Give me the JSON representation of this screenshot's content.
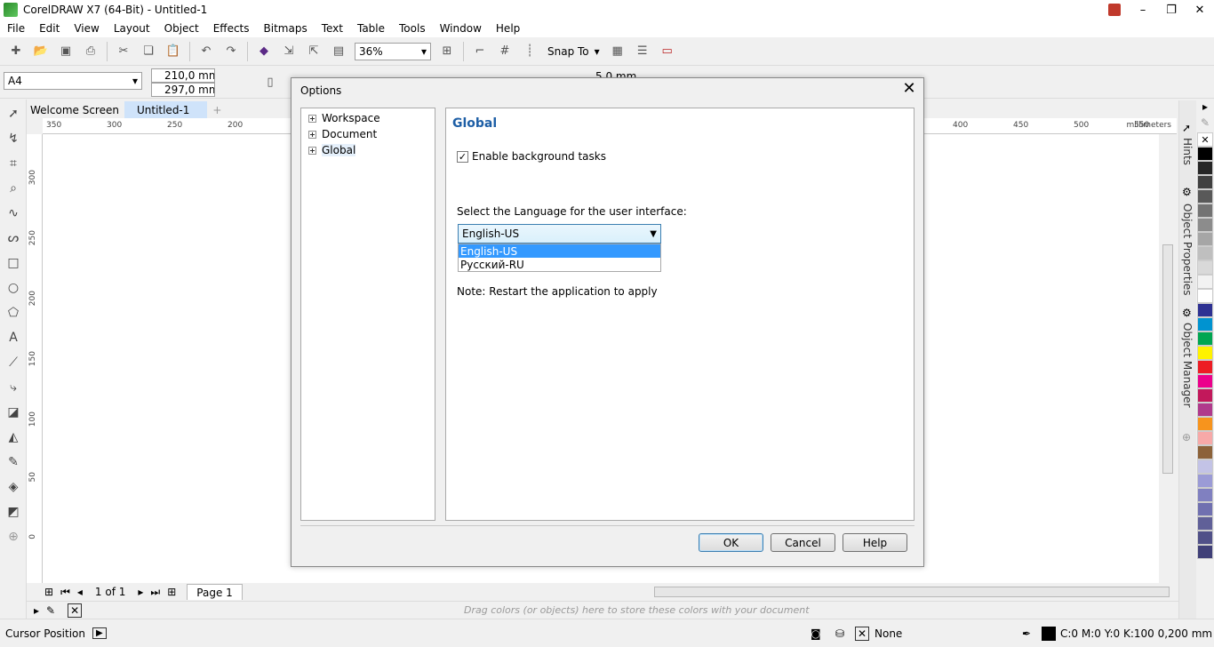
{
  "window": {
    "title": "CorelDRAW X7 (64-Bit) - Untitled-1"
  },
  "menu": [
    "File",
    "Edit",
    "View",
    "Layout",
    "Object",
    "Effects",
    "Bitmaps",
    "Text",
    "Table",
    "Tools",
    "Window",
    "Help"
  ],
  "toolbar": {
    "zoom": "36%",
    "snap_label": "Snap To"
  },
  "property_bar": {
    "page_size": "A4",
    "width": "210,0 mm",
    "height": "297,0 mm",
    "nudge": "5,0 mm"
  },
  "tabs": {
    "welcome": "Welcome Screen",
    "doc": "Untitled-1"
  },
  "ruler": {
    "units": "millimeters",
    "h_ticks": [
      "350",
      "300",
      "250",
      "200",
      "400",
      "450",
      "500",
      "550"
    ],
    "v_ticks": [
      "300",
      "250",
      "200",
      "150",
      "100",
      "50",
      "0"
    ]
  },
  "page_nav": {
    "position": "1 of 1",
    "page": "Page 1"
  },
  "doc_palette": {
    "hint": "Drag colors (or objects) here to store these colors with your document"
  },
  "status": {
    "cursor": "Cursor Position",
    "fill": "None",
    "outline": "C:0 M:0 Y:0 K:100  0,200 mm"
  },
  "dockers": [
    "Hints",
    "Object Properties",
    "Object Manager"
  ],
  "palette_colors": [
    "#000000",
    "#262626",
    "#404040",
    "#595959",
    "#737373",
    "#8c8c8c",
    "#a6a6a6",
    "#bfbfbf",
    "#d9d9d9",
    "#f2f2f2",
    "#ffffff",
    "#2e3192",
    "#0093d0",
    "#00a651",
    "#fff200",
    "#ed1c24",
    "#ec008c",
    "#c2185b",
    "#b03a8c",
    "#f7941d",
    "#f7a9a8",
    "#8c6239",
    "#c3c3e6",
    "#9b9bd6",
    "#8080c0",
    "#7070b0",
    "#606098",
    "#505088",
    "#404078"
  ],
  "dialog": {
    "title": "Options",
    "tree": [
      "Workspace",
      "Document",
      "Global"
    ],
    "heading": "Global",
    "checkbox_label": "Enable background tasks",
    "language_label": "Select the Language for the user interface:",
    "selected_language": "English-US",
    "options": [
      "English-US",
      "Русский-RU"
    ],
    "note": "Note: Restart the application to apply",
    "ok": "OK",
    "cancel": "Cancel",
    "help": "Help"
  }
}
